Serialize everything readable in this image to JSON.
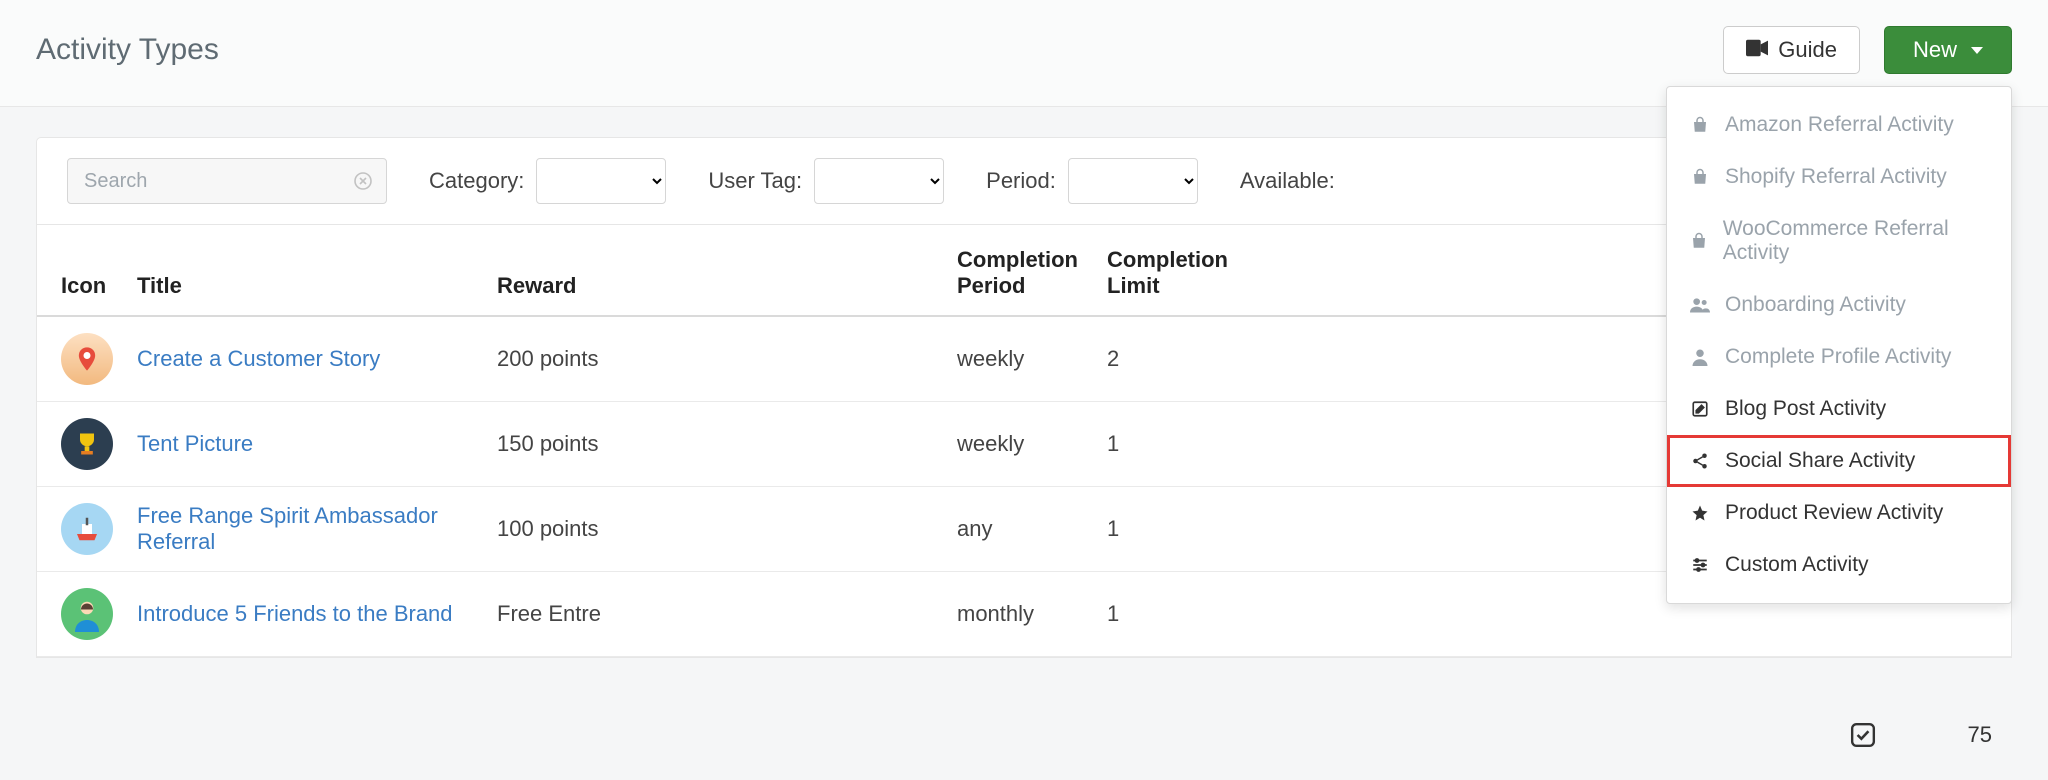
{
  "header": {
    "title": "Activity Types",
    "guide_label": "Guide",
    "new_label": "New"
  },
  "filters": {
    "search_placeholder": "Search",
    "category_label": "Category:",
    "user_tag_label": "User Tag:",
    "period_label": "Period:",
    "available_label": "Available:"
  },
  "table": {
    "columns": {
      "icon": "Icon",
      "title": "Title",
      "reward": "Reward",
      "completion_period": "Completion Period",
      "completion_limit": "Completion Limit"
    },
    "rows": [
      {
        "icon": "pin-icon",
        "title": "Create a Customer Story",
        "reward": "200 points",
        "period": "weekly",
        "limit": "2"
      },
      {
        "icon": "trophy-icon",
        "title": "Tent Picture",
        "reward": "150 points",
        "period": "weekly",
        "limit": "1"
      },
      {
        "icon": "ship-icon",
        "title": "Free Range Spirit Ambassador Referral",
        "reward": "100 points",
        "period": "any",
        "limit": "1"
      },
      {
        "icon": "person-icon",
        "title": "Introduce 5 Friends to the Brand",
        "reward": "Free Entre",
        "period": "monthly",
        "limit": "1"
      }
    ]
  },
  "dropdown": {
    "items": [
      {
        "icon": "bag-icon",
        "label": "Amazon Referral Activity",
        "enabled": false
      },
      {
        "icon": "bag-icon",
        "label": "Shopify Referral Activity",
        "enabled": false
      },
      {
        "icon": "bag-icon",
        "label": "WooCommerce Referral Activity",
        "enabled": false
      },
      {
        "icon": "users-icon",
        "label": "Onboarding Activity",
        "enabled": false
      },
      {
        "icon": "user-icon",
        "label": "Complete Profile Activity",
        "enabled": false
      },
      {
        "icon": "edit-icon",
        "label": "Blog Post Activity",
        "enabled": true
      },
      {
        "icon": "share-icon",
        "label": "Social Share Activity",
        "enabled": true,
        "highlight": true
      },
      {
        "icon": "star-icon",
        "label": "Product Review Activity",
        "enabled": true
      },
      {
        "icon": "sliders-icon",
        "label": "Custom Activity",
        "enabled": true
      }
    ]
  },
  "peek_row": {
    "badge_icon": "check-badge-icon",
    "value": "75"
  }
}
